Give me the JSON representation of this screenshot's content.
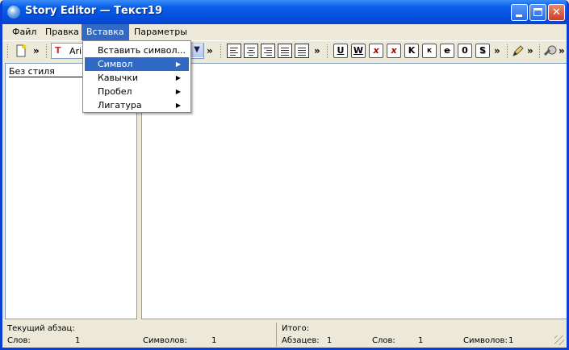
{
  "window": {
    "title": "Story Editor — Текст19"
  },
  "menubar": {
    "items": [
      "Файл",
      "Правка",
      "Вставка",
      "Параметры"
    ],
    "active": "Вставка"
  },
  "toolbar": {
    "font_name": "Arial",
    "more_glyph": "»",
    "format_buttons": [
      "U",
      "W",
      "x",
      "x",
      "K",
      "к",
      "e",
      "0",
      "S"
    ]
  },
  "insert_menu": {
    "items": [
      {
        "label": "Вставить символ...",
        "has_submenu": false
      },
      {
        "label": "Символ",
        "has_submenu": true
      },
      {
        "label": "Кавычки",
        "has_submenu": true
      },
      {
        "label": "Пробел",
        "has_submenu": true
      },
      {
        "label": "Лигатура",
        "has_submenu": true
      }
    ],
    "submenu_glyph": "▶"
  },
  "style_pane": {
    "items": [
      "Без стиля"
    ]
  },
  "status": {
    "current_paragraph_label": "Текущий абзац:",
    "words_label": "Слов:",
    "words_value": "1",
    "chars_label": "Символов:",
    "chars_value": "1",
    "total_label": "Итого:",
    "paragraphs_label": "Абзацев:",
    "paragraphs_value": "1",
    "total_words_label": "Слов:",
    "total_words_value": "1",
    "total_chars_label": "Символов:",
    "total_chars_value": "1"
  },
  "colors": {
    "titlebar": "#0a5ee8",
    "menu_highlight": "#316ac5",
    "chrome": "#ece9d8"
  }
}
